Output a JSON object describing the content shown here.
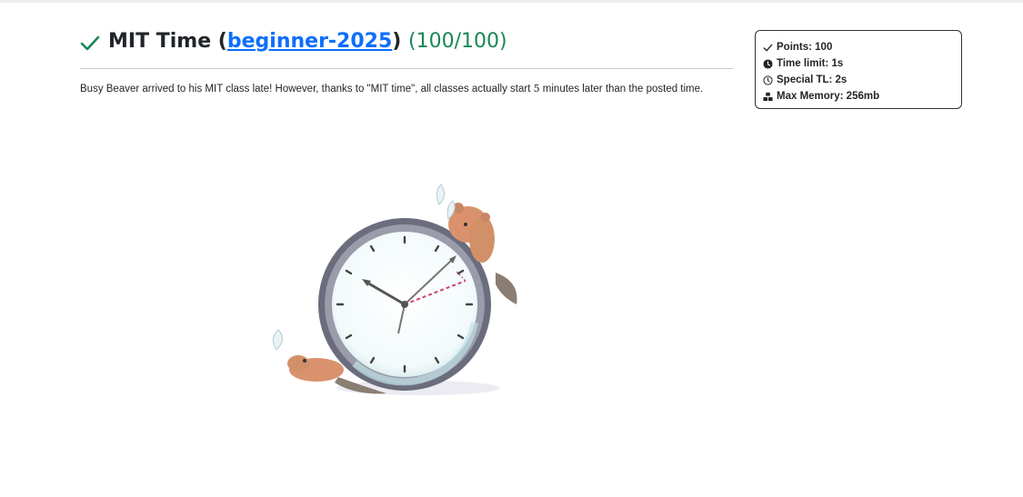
{
  "problem": {
    "title": "MIT Time",
    "open_paren": " (",
    "contest_label": "beginner-2025",
    "close_paren": ")",
    "score": "(100/100)",
    "statement": {
      "part1": "Busy Beaver arrived to his MIT class late! However, thanks to \"MIT time\", all classes actually start ",
      "number": "5",
      "part2": " minutes later than the posted time."
    }
  },
  "info_box": {
    "points": "Points: 100",
    "time_limit": "Time limit: 1s",
    "special_tl": "Special TL: 2s",
    "max_memory": "Max Memory: 256mb"
  },
  "colors": {
    "solved_green": "#198754",
    "link_blue": "#0d6efd",
    "text": "#212529"
  },
  "icons": {
    "status": "check-icon",
    "points": "check-icon",
    "time_limit": "clock-solid-icon",
    "special_tl": "clock-outline-icon",
    "max_memory": "memory-icon"
  },
  "illustration": "beaver-clock-image"
}
